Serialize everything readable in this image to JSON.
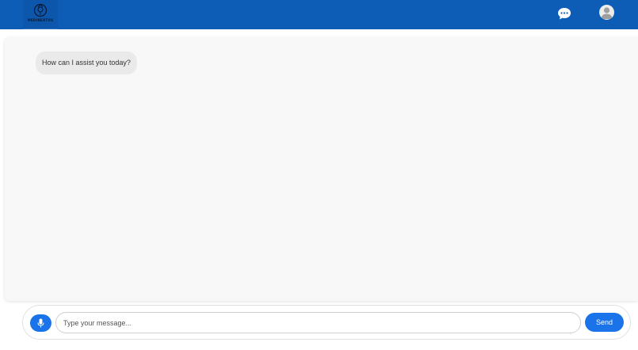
{
  "header": {
    "logo_text": "MEDINEXTUS",
    "chat_icon": "chat-bubble-dots-icon",
    "avatar_icon": "user-avatar-icon",
    "bar_color": "#0d5cb6"
  },
  "chat": {
    "messages": [
      {
        "sender": "bot",
        "text": "How can I assist you today?"
      }
    ]
  },
  "composer": {
    "mic_icon": "microphone-icon",
    "placeholder": "Type your message...",
    "value": "",
    "send_label": "Send",
    "accent_color": "#1a73e8"
  }
}
